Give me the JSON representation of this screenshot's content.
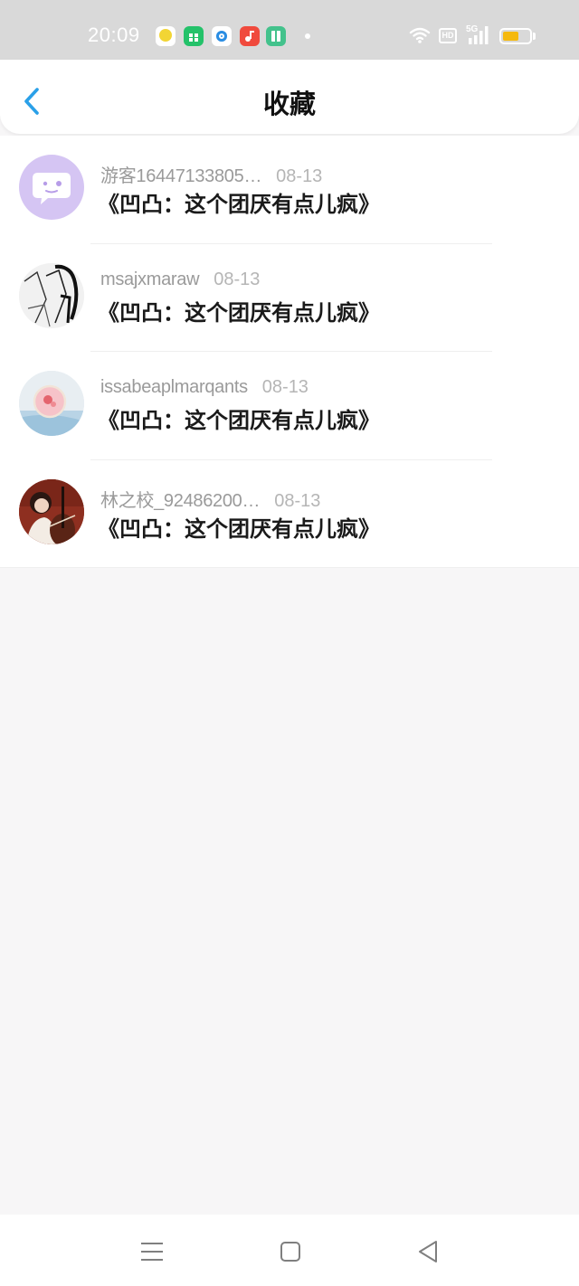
{
  "status_bar": {
    "time": "20:09",
    "hd_label": "HD",
    "network_label": "5G",
    "battery_level": 0.6,
    "icons": [
      "app-notification-icon",
      "app-store-icon",
      "browser-icon",
      "music-icon",
      "reader-icon",
      "wifi-icon",
      "signal-icon",
      "battery-icon"
    ]
  },
  "header": {
    "title": "收藏",
    "back_icon": "chevron-left-icon",
    "accent_color": "#2aa0e8"
  },
  "favorites": [
    {
      "username": "游客16447133805…",
      "date": "08-13",
      "title": "《凹凸：这个团厌有点儿疯》",
      "avatar": "chat-bubble-avatar"
    },
    {
      "username": "msajxmaraw",
      "date": "08-13",
      "title": "《凹凸：这个团厌有点儿疯》",
      "avatar": "sketch-avatar"
    },
    {
      "username": "issabeaplmarqants",
      "date": "08-13",
      "title": "《凹凸：这个团厌有点儿疯》",
      "avatar": "pendant-avatar"
    },
    {
      "username": "林之校_92486200…",
      "date": "08-13",
      "title": "《凹凸：这个团厌有点儿疯》",
      "avatar": "cello-girl-avatar"
    }
  ],
  "system_nav": {
    "icons": [
      "menu-icon",
      "home-icon",
      "back-triangle-icon"
    ]
  }
}
